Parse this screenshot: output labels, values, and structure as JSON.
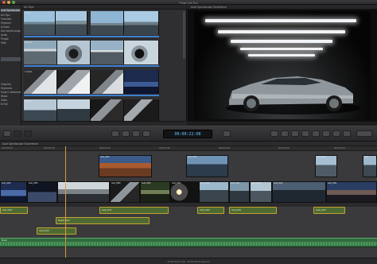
{
  "window": {
    "title": "Final Cut Pro"
  },
  "library": {
    "rows": [
      "Audi Spectacular Experience",
      "All Clips",
      "Favorites",
      "Rejected",
      "Unused",
      "Ads Needs Analysis",
      "Audio",
      "People",
      "Stills",
      "",
      "Graphics",
      "Keywords",
      "Smart Collections",
      "Music",
      "Video",
      "B-Roll"
    ]
  },
  "browser": {
    "header": "All Clips",
    "clips": [
      "Track",
      "Wheels",
      "Cockpit",
      "Interior",
      "Road"
    ]
  },
  "viewer": {
    "header": "Audi Spectacular Experience"
  },
  "toolbar": {
    "timecode": "00:00:22:08"
  },
  "timeline": {
    "path": "Audi Spectacular Experience",
    "ruler": [
      "00:00:00:00",
      "00:00:05:00",
      "00:00:10:00",
      "00:00:15:00",
      "00:00:20:00",
      "00:00:25:00",
      "00:00:30:00"
    ],
    "upper_clips": [
      "Audi_0302",
      "Audi_0319",
      "Audi_0324",
      "Audi"
    ],
    "primary_clips": [
      "Audi_0203",
      "Audi_0205",
      "Audi_0197",
      "Audi_0206",
      "Audi_0246",
      "Audi_0224",
      "Audi_0238",
      "Audi_0251",
      "Audi_0318",
      "Audi_0212",
      "Audi_0321"
    ],
    "audio_clips": [
      "Audi_0247",
      "Audi_0271",
      "Audi_0309",
      "Audi_0251",
      "Audi_0243"
    ],
    "lower_clips": [
      "Engine Revs",
      "Audi_0218"
    ],
    "music": "Music",
    "status": "00:00:39:01 total - 00:00:39:02 selected"
  },
  "colors": {
    "accent": "#5fc9ff",
    "selection": "#3f7fd0",
    "connected": "#e0b32a",
    "music": "#2f6a3d",
    "playhead": "#d99a42"
  }
}
